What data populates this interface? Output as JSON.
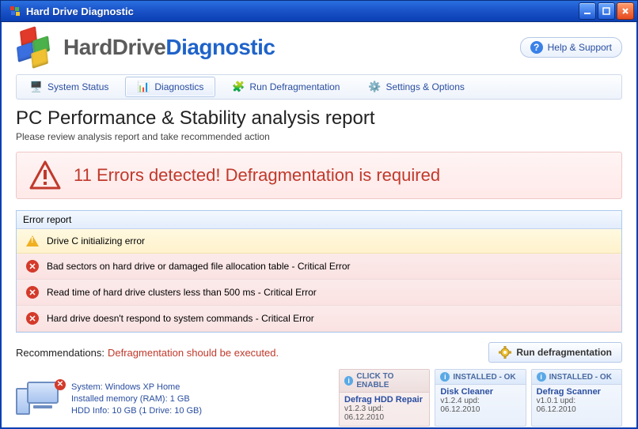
{
  "window": {
    "title": "Hard Drive Diagnostic"
  },
  "brand": {
    "part1": "HardDrive",
    "part2": "Diagnostic"
  },
  "help": {
    "label": "Help & Support"
  },
  "nav": {
    "items": [
      {
        "label": "System Status",
        "icon": "🖥️"
      },
      {
        "label": "Diagnostics",
        "icon": "📊"
      },
      {
        "label": "Run Defragmentation",
        "icon": "🧩"
      },
      {
        "label": "Settings & Options",
        "icon": "⚙️"
      }
    ],
    "active_index": 1
  },
  "page": {
    "title": "PC Performance & Stability analysis report",
    "subtitle": "Please review analysis report and take recommended action"
  },
  "alert": {
    "text": "11 Errors detected! Defragmentation is required"
  },
  "report": {
    "header": "Error report",
    "rows": [
      {
        "type": "warn",
        "text": "Drive C initializing error"
      },
      {
        "type": "crit",
        "text": "Bad sectors on hard drive or damaged file allocation table - Critical Error"
      },
      {
        "type": "crit",
        "text": "Read time of hard drive clusters less than 500 ms - Critical Error"
      },
      {
        "type": "crit",
        "text": "Hard drive doesn't respond to system commands - Critical Error"
      }
    ]
  },
  "recommendation": {
    "label": "Recommendations:",
    "text": "Defragmentation should be executed.",
    "button": "Run defragmentation"
  },
  "system": {
    "line1": "System: Windows XP Home",
    "line2": "Installed memory (RAM): 1 GB",
    "line3": "HDD Info: 10 GB (1 Drive: 10 GB)"
  },
  "modules": [
    {
      "status": "CLICK TO ENABLE",
      "kind": "enable",
      "name": "Defrag HDD Repair",
      "ver": "v1.2.3 upd: 06.12.2010"
    },
    {
      "status": "INSTALLED - OK",
      "kind": "ok",
      "name": "Disk Cleaner",
      "ver": "v1.2.4 upd: 06.12.2010"
    },
    {
      "status": "INSTALLED - OK",
      "kind": "ok",
      "name": "Defrag Scanner",
      "ver": "v1.0.1 upd: 06.12.2010"
    }
  ],
  "colors": {
    "accent_blue": "#1f63c9",
    "error_red": "#c0392b"
  }
}
